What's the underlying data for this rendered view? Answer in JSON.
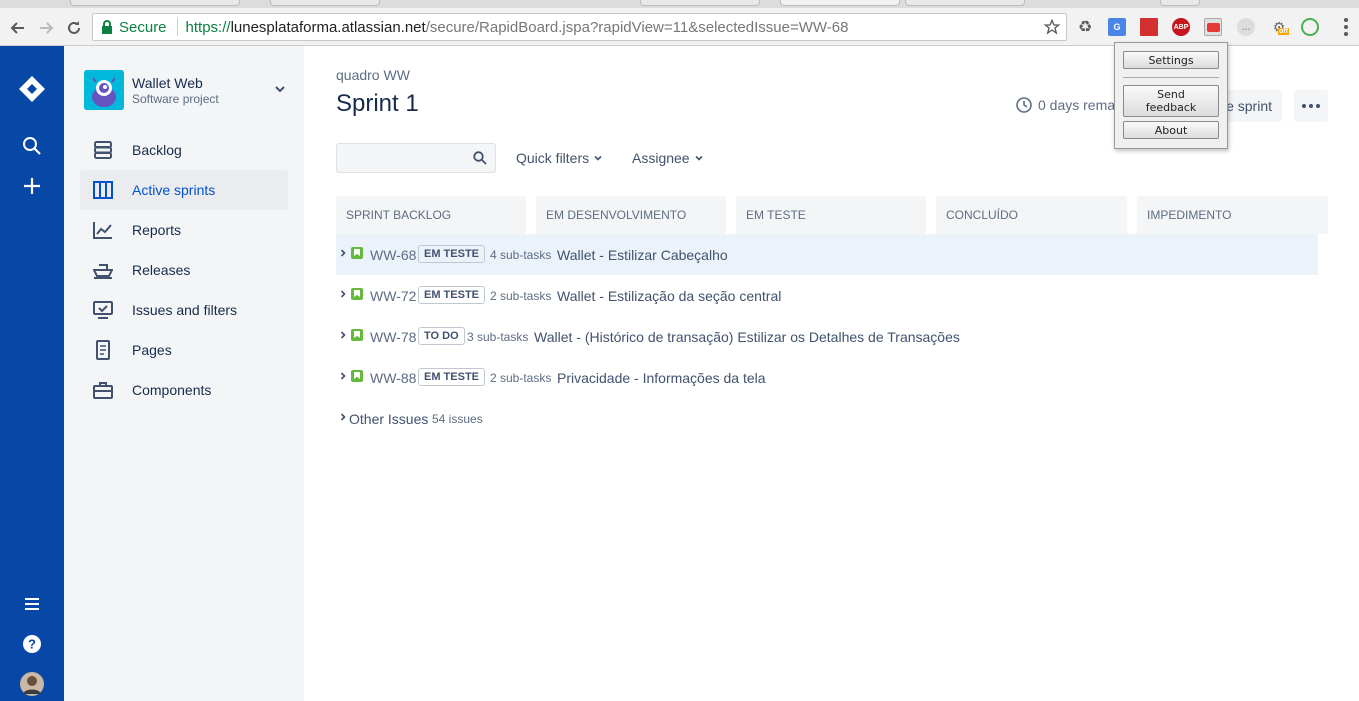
{
  "browser": {
    "url_secure_label": "Secure",
    "url_protocol": "https://",
    "url_host": "lunesplataforma.atlassian.net",
    "url_path": "/secure/RapidBoard.jspa?rapidView=11&selectedIssue=WW-68",
    "extension_badge_abp": "ABP",
    "extension_badge_off": "off"
  },
  "project": {
    "name": "Wallet Web",
    "type": "Software project"
  },
  "sidebar": {
    "items": [
      {
        "label": "Backlog"
      },
      {
        "label": "Active sprints"
      },
      {
        "label": "Reports"
      },
      {
        "label": "Releases"
      },
      {
        "label": "Issues and filters"
      },
      {
        "label": "Pages"
      },
      {
        "label": "Components"
      }
    ]
  },
  "board": {
    "breadcrumb": "quadro WW",
    "title": "Sprint 1",
    "remaining": "0 days rema",
    "complete_label": "e sprint",
    "search_value": "",
    "filters": {
      "quick": "Quick filters",
      "assignee": "Assignee"
    },
    "columns": [
      "SPRINT BACKLOG",
      "EM DESENVOLVIMENTO",
      "EM TESTE",
      "CONCLUÍDO",
      "IMPEDIMENTO"
    ],
    "issues": [
      {
        "key": "WW-68",
        "status": "EM TESTE",
        "subtasks": "4 sub-tasks",
        "summary": "Wallet - Estilizar Cabeçalho"
      },
      {
        "key": "WW-72",
        "status": "EM TESTE",
        "subtasks": "2 sub-tasks",
        "summary": "Wallet - Estilização da seção central"
      },
      {
        "key": "WW-78",
        "status": "TO DO",
        "subtasks": "3 sub-tasks",
        "summary": "Wallet - (Histórico de transação) Estilizar os Detalhes de Transações"
      },
      {
        "key": "WW-88",
        "status": "EM TESTE",
        "subtasks": "2 sub-tasks",
        "summary": "Privacidade - Informações da tela"
      }
    ],
    "other_issues": {
      "label": "Other Issues",
      "count": "54 issues"
    }
  },
  "popup": {
    "settings": "Settings",
    "send_feedback_line1": "Send",
    "send_feedback_line2": "feedback",
    "about": "About"
  },
  "colors": {
    "global_nav": "#0747a6",
    "sidebar_bg": "#f4f5f7",
    "active_link": "#0052cc",
    "story_green": "#63ba3c",
    "selected_lane": "#ebf2fa"
  }
}
